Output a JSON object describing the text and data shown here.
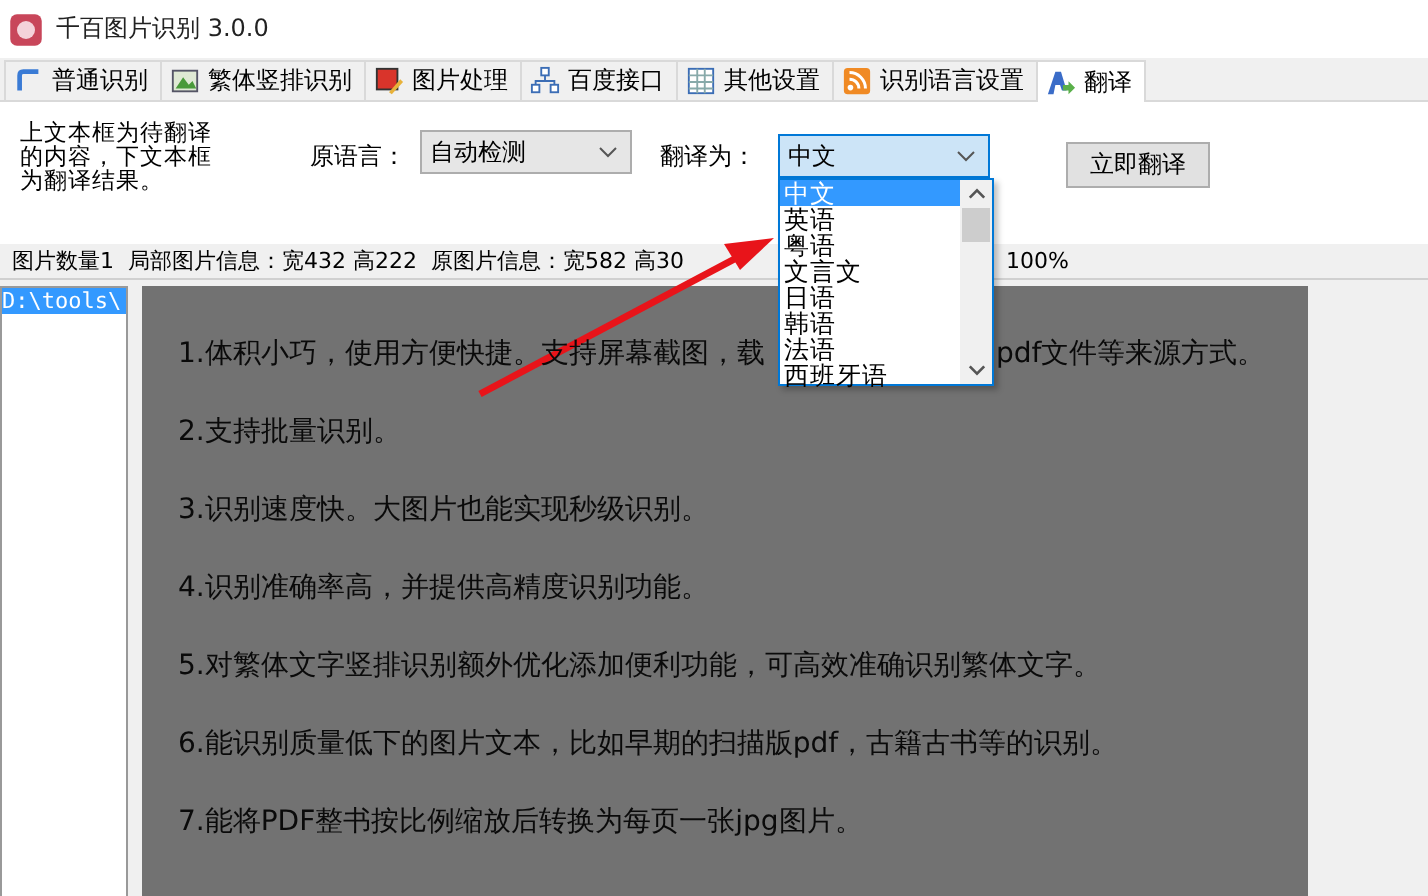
{
  "window": {
    "title": "千百图片识别 3.0.0"
  },
  "tabs": [
    {
      "label": "普通识别",
      "selected": false
    },
    {
      "label": "繁体竖排识别",
      "selected": false
    },
    {
      "label": "图片处理",
      "selected": false
    },
    {
      "label": "百度接口",
      "selected": false
    },
    {
      "label": "其他设置",
      "selected": false
    },
    {
      "label": "识别语言设置",
      "selected": false
    },
    {
      "label": "翻译",
      "selected": true
    }
  ],
  "translate_panel": {
    "hint": "上文本框为待翻译的内容，下文本框为翻译结果。",
    "source_label": "原语言：",
    "source_value": "自动检测",
    "target_label": "翻译为：",
    "target_value": "中文",
    "translate_button": "立即翻译"
  },
  "language_dropdown": {
    "items": [
      {
        "label": "中文",
        "selected": true
      },
      {
        "label": "英语",
        "selected": false
      },
      {
        "label": "粤语",
        "selected": false
      },
      {
        "label": "文言文",
        "selected": false
      },
      {
        "label": "日语",
        "selected": false
      },
      {
        "label": "韩语",
        "selected": false
      },
      {
        "label": "法语",
        "selected": false
      },
      {
        "label": "西班牙语",
        "selected": false
      }
    ]
  },
  "status_bar": [
    "图片数量1",
    "局部图片信息：宽432 高222",
    "原图片信息：宽582 高30",
    "100%"
  ],
  "file_list": [
    {
      "label": "D:\\tools\\",
      "selected": true
    }
  ],
  "image_preview": {
    "line_1_start": "1.体积小巧，使用方便快捷。支持屏幕截图，载",
    "line_1_end": "pdf文件等来源方式。",
    "lines": [
      "2.支持批量识别。",
      "3.识别速度快。大图片也能实现秒级识别。",
      "4.识别准确率高，并提供高精度识别功能。",
      "5.对繁体文字竖排识别额外优化添加便利功能，可高效准确识别繁体文字。",
      "6.能识别质量低下的图片文本，比如早期的扫描版pdf，古籍古书等的识别。",
      "7.能将PDF整书按比例缩放后转换为每页一张jpg图片。"
    ]
  }
}
